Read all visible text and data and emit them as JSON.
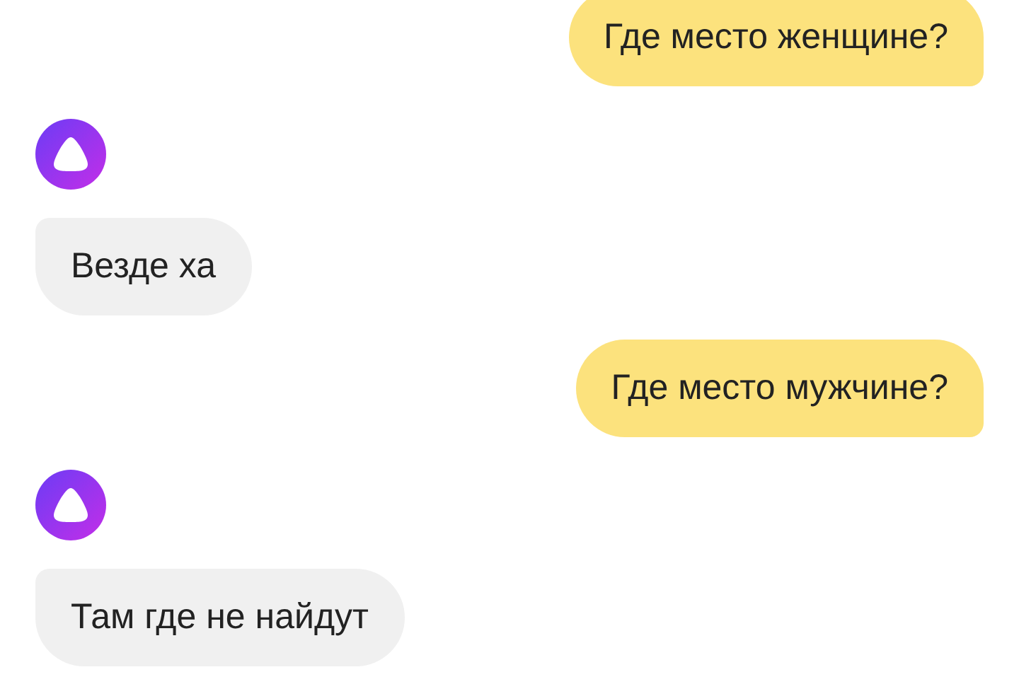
{
  "messages": [
    {
      "kind": "user",
      "text": "Где место женщине?"
    },
    {
      "kind": "bot",
      "text": "Везде ха"
    },
    {
      "kind": "user",
      "text": "Где место мужчине?"
    },
    {
      "kind": "bot",
      "text": "Там где не найдут"
    }
  ]
}
